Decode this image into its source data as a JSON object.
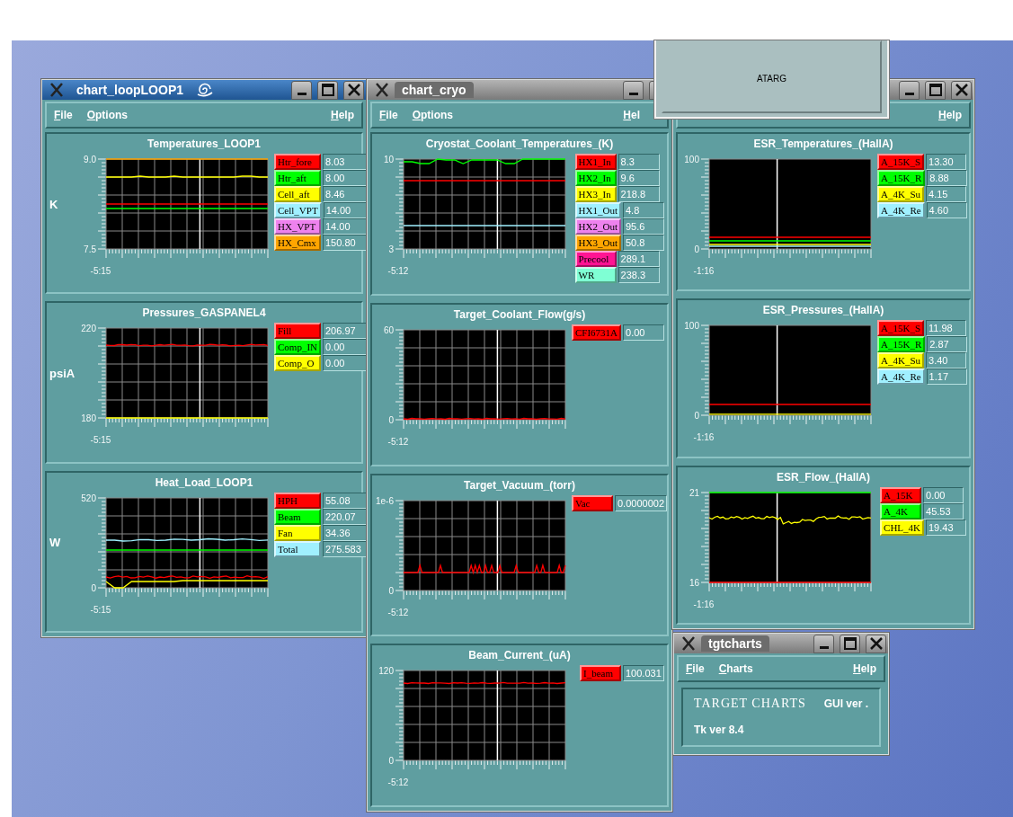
{
  "windows": [
    {
      "title": "chart_loopLOOP1",
      "active": true,
      "menu": [
        {
          "label": "File"
        },
        {
          "label": "Options"
        }
      ],
      "help": "Help",
      "panels": [
        {
          "title": "Temperatures_LOOP1",
          "unit": "K",
          "grid": true,
          "y_max": "9.0",
          "y_min": "7.5",
          "time": "-5:15",
          "legend": [
            {
              "label": "Htr_fore",
              "color": "#ff0000",
              "value": "8.03"
            },
            {
              "label": "Htr_aft",
              "color": "#00ff00",
              "value": "8.00"
            },
            {
              "label": "Cell_aft",
              "color": "#ffff00",
              "value": "8.46"
            },
            {
              "label": "Cell_VPT",
              "color": "#a0f0ff",
              "value": "14.00"
            },
            {
              "label": "HX_VPT",
              "color": "#ee82ee",
              "value": "14.00"
            },
            {
              "label": "HX_Cmx",
              "color": "#ffa500",
              "value": "150.80"
            }
          ]
        },
        {
          "title": "Pressures_GASPANEL4",
          "unit": "psiA",
          "grid": true,
          "y_max": "220",
          "y_min": "180",
          "time": "-5:15",
          "legend": [
            {
              "label": "Fill",
              "color": "#ff0000",
              "value": "206.97"
            },
            {
              "label": "Comp_IN",
              "color": "#00ff00",
              "value": "0.00"
            },
            {
              "label": "Comp_O",
              "color": "#ffff00",
              "value": "0.00"
            }
          ]
        },
        {
          "title": "Heat_Load_LOOP1",
          "unit": "W",
          "grid": true,
          "y_max": "520",
          "y_min": "0",
          "time": "-5:15",
          "legend": [
            {
              "label": "HPH",
              "color": "#ff0000",
              "value": "55.08"
            },
            {
              "label": "Beam",
              "color": "#00ff00",
              "value": "220.07"
            },
            {
              "label": "Fan",
              "color": "#ffff00",
              "value": "34.36"
            },
            {
              "label": "Total",
              "color": "#a0f0ff",
              "value": "275.583"
            }
          ]
        }
      ]
    },
    {
      "title": "chart_cryo",
      "active": false,
      "menu": [
        {
          "label": "File"
        },
        {
          "label": "Options"
        }
      ],
      "help": "Hel",
      "panels": [
        {
          "title": "Cryostat_Coolant_Temperatures_(K)",
          "grid": true,
          "y_max": "10",
          "y_min": "3",
          "time": "-5:12",
          "legend": [
            {
              "label": "HX1_In",
              "color": "#ff0000",
              "value": "8.3"
            },
            {
              "label": "HX2_In",
              "color": "#00ff00",
              "value": "9.6"
            },
            {
              "label": "HX3_In",
              "color": "#ffff00",
              "value": "218.8"
            },
            {
              "label": "HX1_Out",
              "color": "#a0f0ff",
              "value": "4.8"
            },
            {
              "label": "HX2_Out",
              "color": "#ee82ee",
              "value": "95.6"
            },
            {
              "label": "HX3_Out",
              "color": "#ffa500",
              "value": "50.8"
            },
            {
              "label": "Precool",
              "color": "#ff1493",
              "value": "289.1"
            },
            {
              "label": "WR",
              "color": "#7fffd4",
              "value": "238.3"
            }
          ]
        },
        {
          "title": "Target_Coolant_Flow(g/s)",
          "grid": true,
          "y_max": "60",
          "y_min": "0",
          "time": "-5:12",
          "legend": [
            {
              "label": "CFI6731A",
              "color": "#ff0000",
              "value": "0.00"
            }
          ]
        },
        {
          "title": "Target_Vacuum_(torr)",
          "grid": true,
          "y_max": "1e-6",
          "y_min": "0",
          "time": "-5:12",
          "legend": [
            {
              "label": "Vac",
              "color": "#ff0000",
              "value": "0.0000002"
            }
          ]
        },
        {
          "title": "Beam_Current_(uA)",
          "grid": true,
          "y_max": "120",
          "y_min": "0",
          "time": "-5:12",
          "legend": [
            {
              "label": "I_beam",
              "color": "#ff0000",
              "value": "100.031"
            }
          ]
        }
      ]
    },
    {
      "help": "Help",
      "panels": [
        {
          "title": "ESR_Temperatures_(HallA)",
          "grid": false,
          "y_max": "100",
          "y_min": "0",
          "time": "-1:16",
          "legend": [
            {
              "label": "A_15K_S",
              "color": "#ff0000",
              "value": "13.30"
            },
            {
              "label": "A_15K_R",
              "color": "#00ff00",
              "value": "8.88"
            },
            {
              "label": "A_4K_Su",
              "color": "#ffff00",
              "value": "4.15"
            },
            {
              "label": "A_4K_Re",
              "color": "#a0f0ff",
              "value": "4.60"
            }
          ]
        },
        {
          "title": "ESR_Pressures_(HallA)",
          "grid": false,
          "y_max": "100",
          "y_min": "0",
          "time": "-1:16",
          "legend": [
            {
              "label": "A_15K_S",
              "color": "#ff0000",
              "value": "11.98"
            },
            {
              "label": "A_15K_R",
              "color": "#00ff00",
              "value": "2.87"
            },
            {
              "label": "A_4K_Su",
              "color": "#ffff00",
              "value": "3.40"
            },
            {
              "label": "A_4K_Re",
              "color": "#a0f0ff",
              "value": "1.17"
            }
          ]
        },
        {
          "title": "ESR_Flow_(HallA)",
          "grid": false,
          "y_max": "21",
          "y_min": "16",
          "time": "-1:16",
          "legend": [
            {
              "label": "A_15K",
              "color": "#ff0000",
              "value": "0.00"
            },
            {
              "label": "A_4K",
              "color": "#00ff00",
              "value": "45.53"
            },
            {
              "label": "CHL_4K",
              "color": "#ffff00",
              "value": "19.43"
            }
          ]
        }
      ]
    }
  ],
  "overlay_window": {
    "label": "ATARG"
  },
  "about_window": {
    "title": "tgtcharts",
    "active": false,
    "menu": [
      {
        "label": "File"
      },
      {
        "label": "Charts"
      }
    ],
    "help": "Help",
    "heading": "TARGET CHARTS",
    "gui_version": "GUI ver .",
    "tk_version": "Tk ver 8.4"
  }
}
